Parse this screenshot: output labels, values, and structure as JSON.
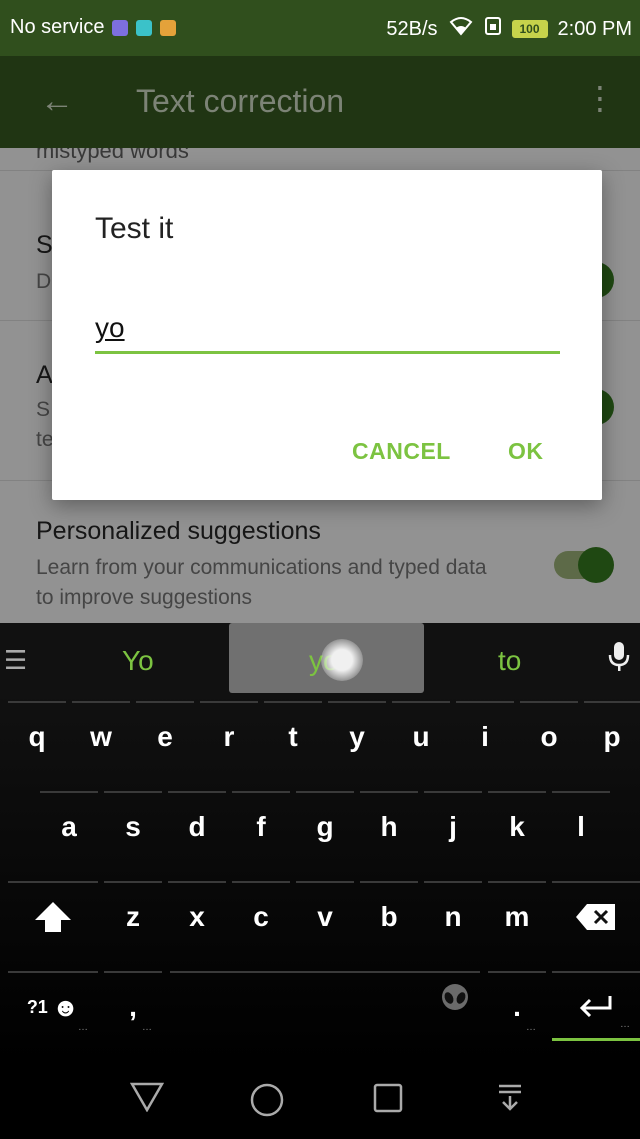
{
  "status_bar": {
    "carrier": "No service",
    "net_speed": "52B/s",
    "battery": "100",
    "time": "2:00 PM",
    "app_icon_colors": [
      "#7d6fe0",
      "#3bc2c9",
      "#e4a23a"
    ]
  },
  "app_bar": {
    "back_icon": "arrow-left-icon",
    "title": "Text correction",
    "more_icon": "more-vert-icon"
  },
  "settings": {
    "cut_text": "mistyped words",
    "rows": [
      {
        "title": "S",
        "summary": "D"
      },
      {
        "title": "A",
        "summary": "S\nte"
      },
      {
        "title": "Personalized suggestions",
        "summary": "Learn from your communications and typed data to improve suggestions"
      }
    ]
  },
  "dialog": {
    "title": "Test it",
    "input_value": "yo",
    "cancel_label": "CANCEL",
    "ok_label": "OK"
  },
  "keyboard": {
    "suggestions": [
      "Yo",
      "yo",
      "to"
    ],
    "row1": [
      "q",
      "w",
      "e",
      "r",
      "t",
      "y",
      "u",
      "i",
      "o",
      "p"
    ],
    "row2": [
      "a",
      "s",
      "d",
      "f",
      "g",
      "h",
      "j",
      "k",
      "l"
    ],
    "row3": [
      "z",
      "x",
      "c",
      "v",
      "b",
      "n",
      "m"
    ],
    "symbols_label": "?1",
    "comma_label": ",",
    "period_label": ".",
    "enter_icon": "enter-icon",
    "accent_color": "#7cc341"
  },
  "nav_bar": {
    "icons": [
      "back-triangle-icon",
      "home-circle-icon",
      "recents-square-icon",
      "notifications-pull-icon"
    ]
  }
}
